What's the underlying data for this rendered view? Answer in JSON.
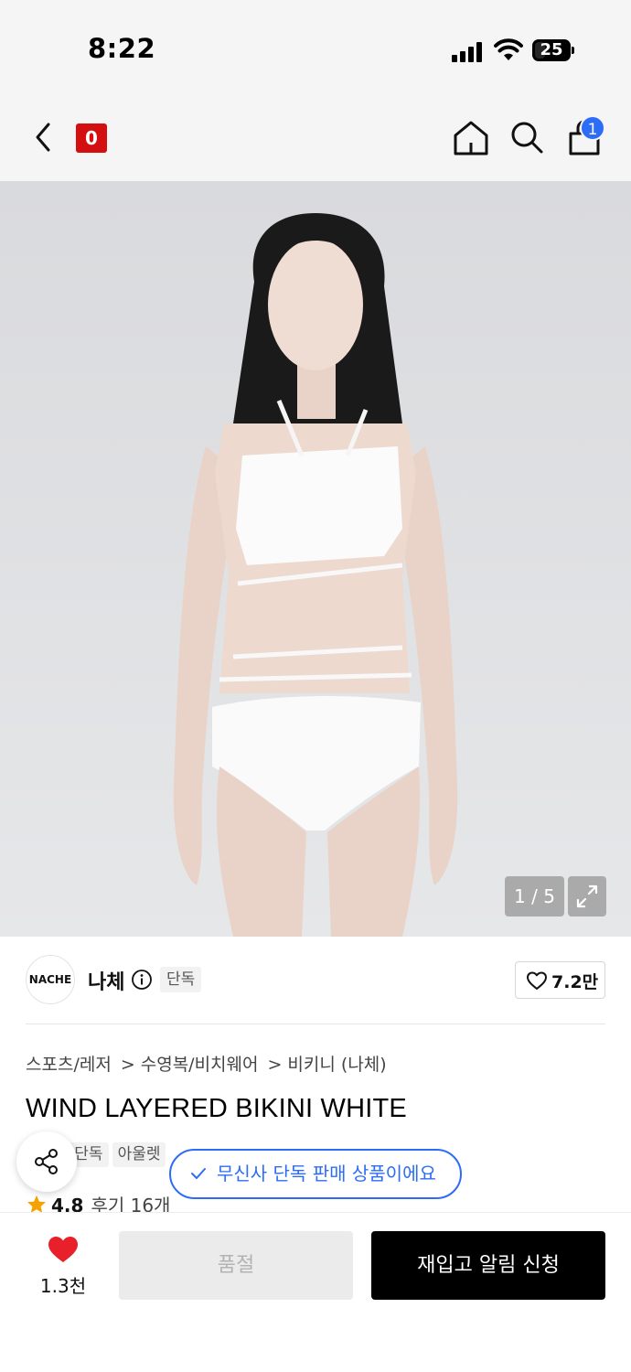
{
  "status_bar": {
    "time": "8:22",
    "battery": "25"
  },
  "header": {
    "brand_logo_text": "0",
    "cart_count": "1"
  },
  "gallery": {
    "counter": "1 / 5"
  },
  "brand": {
    "logo_text": "NACHE",
    "name": "나체",
    "exclusive_tag": "단독",
    "likes": "7.2만"
  },
  "breadcrumb": {
    "items": [
      "스포츠/레저",
      "수영복/비치웨어",
      "비키니 (나체)"
    ],
    "separator": ">"
  },
  "product": {
    "title": "WIND LAYERED BIKINI WHITE",
    "tags": [
      "단독",
      "아울렛"
    ],
    "exclusive_banner": "무신사 단독 판매 상품이에요",
    "rating": "4.8",
    "reviews": "후기 16개"
  },
  "bottom_bar": {
    "wish_count": "1.3천",
    "soldout_label": "품절",
    "restock_label": "재입고 알림 신청"
  },
  "colors": {
    "accent_blue": "#2c6cf6",
    "brand_red": "#d40f0f",
    "heart_red": "#e8202a",
    "star_orange": "#f5a200"
  }
}
